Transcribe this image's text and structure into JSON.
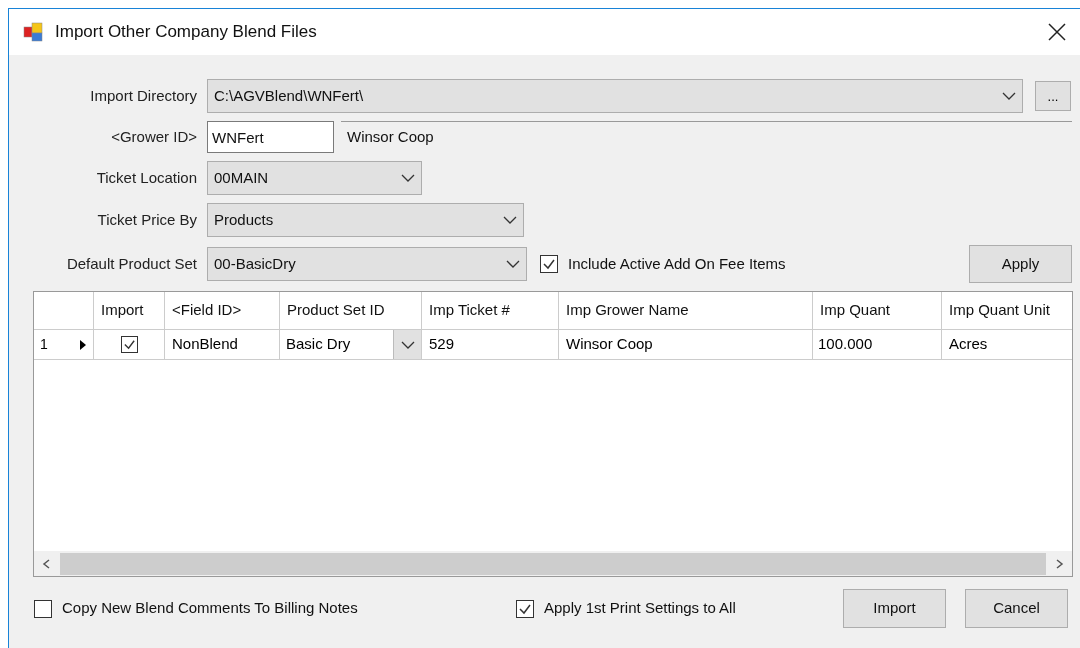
{
  "window": {
    "title": "Import Other Company Blend Files"
  },
  "form": {
    "import_directory": {
      "label": "Import Directory",
      "value": "C:\\AGVBlend\\WNFert\\",
      "browse": "..."
    },
    "grower": {
      "label": "<Grower ID>",
      "value": "WNFert",
      "name": "Winsor Coop"
    },
    "ticket_location": {
      "label": "Ticket Location",
      "value": "00MAIN"
    },
    "ticket_price_by": {
      "label": "Ticket Price By",
      "value": "Products"
    },
    "default_product_set": {
      "label": "Default Product Set",
      "value": "00-BasicDry"
    },
    "include_add_on": {
      "label": "Include Active Add On Fee Items",
      "checked": true
    },
    "apply_button": "Apply"
  },
  "table": {
    "columns": [
      "Import",
      "<Field ID>",
      "Product Set ID",
      "Imp Ticket #",
      "Imp Grower Name",
      "Imp Quant",
      "Imp Quant Unit"
    ],
    "rows": [
      {
        "number": "1",
        "current": true,
        "import": true,
        "field_id": "NonBlend",
        "product_set_id": "Basic Dry",
        "ticket": "529",
        "grower_name": "Winsor Coop",
        "quant": "100.000",
        "quant_unit": "Acres"
      }
    ]
  },
  "footer": {
    "checkboxes": [
      {
        "label": "Copy New Blend Comments To Billing Notes",
        "checked": false
      },
      {
        "label": "Apply 1st Print Settings to All",
        "checked": true
      }
    ],
    "buttons": [
      "Import",
      "Cancel"
    ]
  }
}
